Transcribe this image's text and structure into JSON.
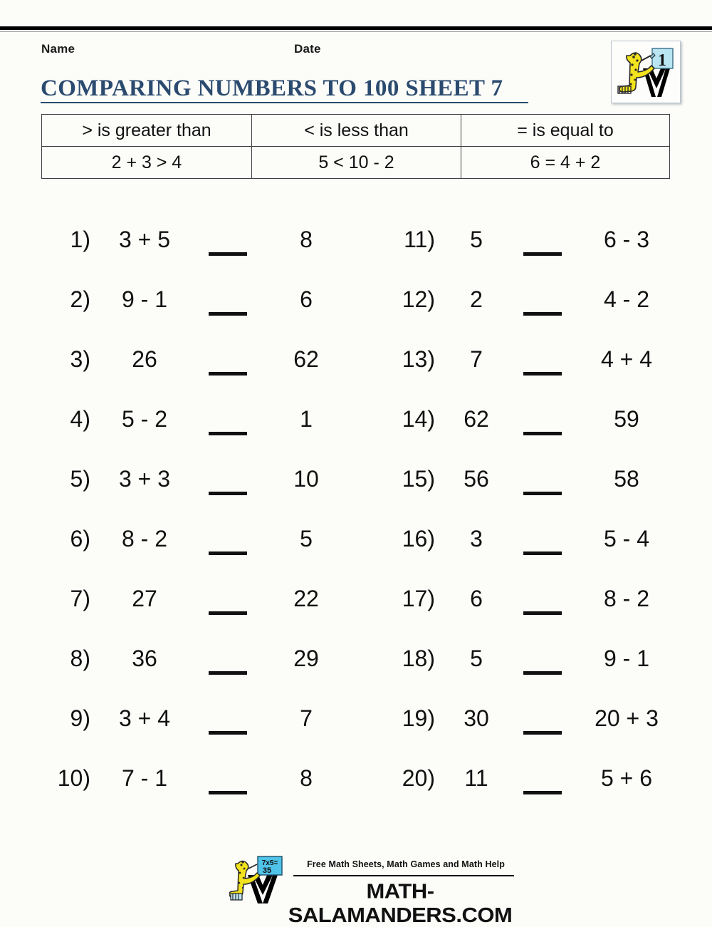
{
  "page": {
    "background_color": "#fcfdf9",
    "rule_color": "#000000"
  },
  "header": {
    "name_label": "Name",
    "date_label": "Date",
    "title": "COMPARING NUMBERS TO 100 SHEET 7",
    "title_color": "#2b4a6f",
    "logo": {
      "icon_name": "math-salamanders-grade-logo",
      "board_text": "1",
      "board_color": "#b9e4f2",
      "salamander_color": "#f2e31e"
    }
  },
  "legend": {
    "headers": [
      "> is greater than",
      "< is less than",
      "= is equal to"
    ],
    "examples": [
      "2 + 3 > 4",
      "5 < 10 - 2",
      "6 = 4 + 2"
    ]
  },
  "problems": {
    "left": [
      {
        "num": "1)",
        "lhs": "3 + 5",
        "blank": "__",
        "rhs": "8"
      },
      {
        "num": "2)",
        "lhs": "9 - 1",
        "blank": "__",
        "rhs": "6"
      },
      {
        "num": "3)",
        "lhs": "26",
        "blank": "__",
        "rhs": "62"
      },
      {
        "num": "4)",
        "lhs": "5 - 2",
        "blank": "__",
        "rhs": "1"
      },
      {
        "num": "5)",
        "lhs": "3 + 3",
        "blank": "__",
        "rhs": "10"
      },
      {
        "num": "6)",
        "lhs": "8 - 2",
        "blank": "__",
        "rhs": "5"
      },
      {
        "num": "7)",
        "lhs": "27",
        "blank": "__",
        "rhs": "22"
      },
      {
        "num": "8)",
        "lhs": "36",
        "blank": "__",
        "rhs": "29"
      },
      {
        "num": "9)",
        "lhs": "3 + 4",
        "blank": "__",
        "rhs": "7"
      },
      {
        "num": "10)",
        "lhs": "7 - 1",
        "blank": "__",
        "rhs": "8"
      }
    ],
    "right": [
      {
        "num": "11)",
        "lhs": "5",
        "blank": "__",
        "rhs": "6 - 3"
      },
      {
        "num": "12)",
        "lhs": "2",
        "blank": "__",
        "rhs": "4 - 2"
      },
      {
        "num": "13)",
        "lhs": "7",
        "blank": "__",
        "rhs": "4 + 4"
      },
      {
        "num": "14)",
        "lhs": "62",
        "blank": "__",
        "rhs": "59"
      },
      {
        "num": "15)",
        "lhs": "56",
        "blank": "__",
        "rhs": "58"
      },
      {
        "num": "16)",
        "lhs": "3",
        "blank": "__",
        "rhs": "5 - 4"
      },
      {
        "num": "17)",
        "lhs": "6",
        "blank": "__",
        "rhs": "8 - 2"
      },
      {
        "num": "18)",
        "lhs": "5",
        "blank": "__",
        "rhs": "9 - 1"
      },
      {
        "num": "19)",
        "lhs": "30",
        "blank": "__",
        "rhs": "20 + 3"
      },
      {
        "num": "20)",
        "lhs": "11",
        "blank": "__",
        "rhs": "5 + 6"
      }
    ]
  },
  "footer": {
    "tagline": "Free Math Sheets, Math Games and Math Help",
    "url": "MATH-SALAMANDERS.COM",
    "logo": {
      "icon_name": "math-salamanders-footer-logo",
      "board_text_line1": "7x5=",
      "board_text_line2": "35",
      "board_color": "#4fc3e8",
      "salamander_color": "#f2e31e"
    }
  }
}
